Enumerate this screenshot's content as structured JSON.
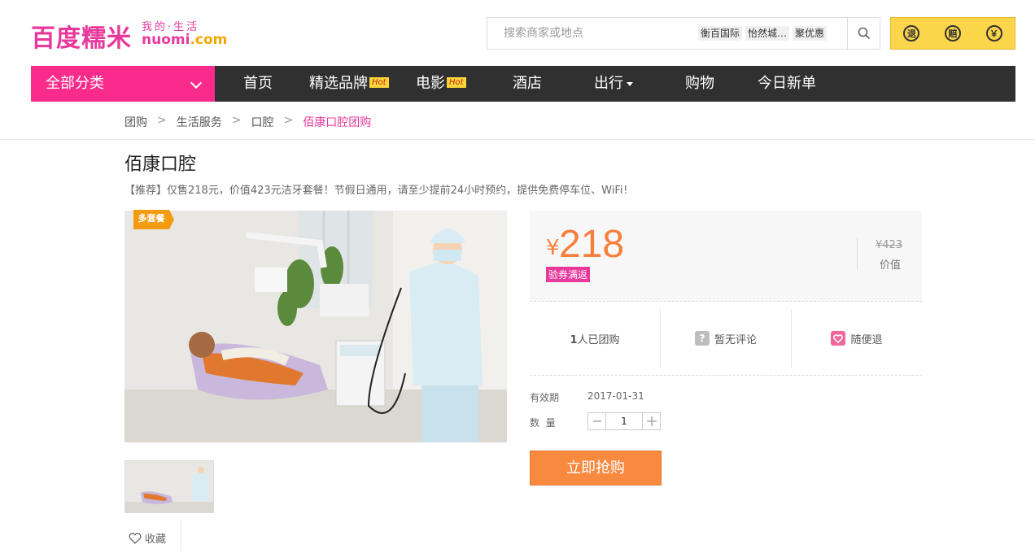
{
  "header": {
    "logo_text": "百度糯米",
    "logo_slogan": "我的·生活",
    "logo_domain_left": "nuomi",
    "logo_domain_right": ".com",
    "search_placeholder": "搜索商家或地点",
    "search_tags": [
      "衡百国际",
      "怡然城…",
      "聚优惠"
    ],
    "guarantees": [
      "退",
      "赔",
      "￥"
    ]
  },
  "nav": {
    "all_categories": "全部分类",
    "items": [
      {
        "label": "首页"
      },
      {
        "label": "精选品牌",
        "badge": "Hot"
      },
      {
        "label": "电影",
        "badge": "Hot"
      },
      {
        "label": "酒店"
      },
      {
        "label": "出行"
      },
      {
        "label": "购物"
      },
      {
        "label": "今日新单"
      }
    ]
  },
  "breadcrumb": [
    "团购",
    "生活服务",
    "口腔",
    "佰康口腔团购"
  ],
  "deal": {
    "title": "佰康口腔",
    "subtitle": "【推荐】仅售218元，价值423元洁牙套餐！节假日通用，请至少提前24小时预约，提供免费停车位、WiFi！",
    "badge": "多套餐",
    "favorite": "收藏",
    "currency": "¥",
    "price": "218",
    "coupon_tag": "验券满返",
    "original_price": "¥423",
    "original_label": "价值",
    "stats": {
      "sold_count": "1",
      "sold_suffix": "人已团购",
      "reviews": "暂无评论",
      "refund": "随便退"
    },
    "validity_label": "有效期",
    "validity_value": "2017-01-31",
    "quantity_label": "数  量",
    "quantity_value": "1",
    "buy_label": "立即抢购"
  },
  "colors": {
    "brand_pink": "#e8389b",
    "price_orange": "#f77f3a",
    "nav_dark": "#303031",
    "guarantee_yellow": "#fbd54a"
  }
}
